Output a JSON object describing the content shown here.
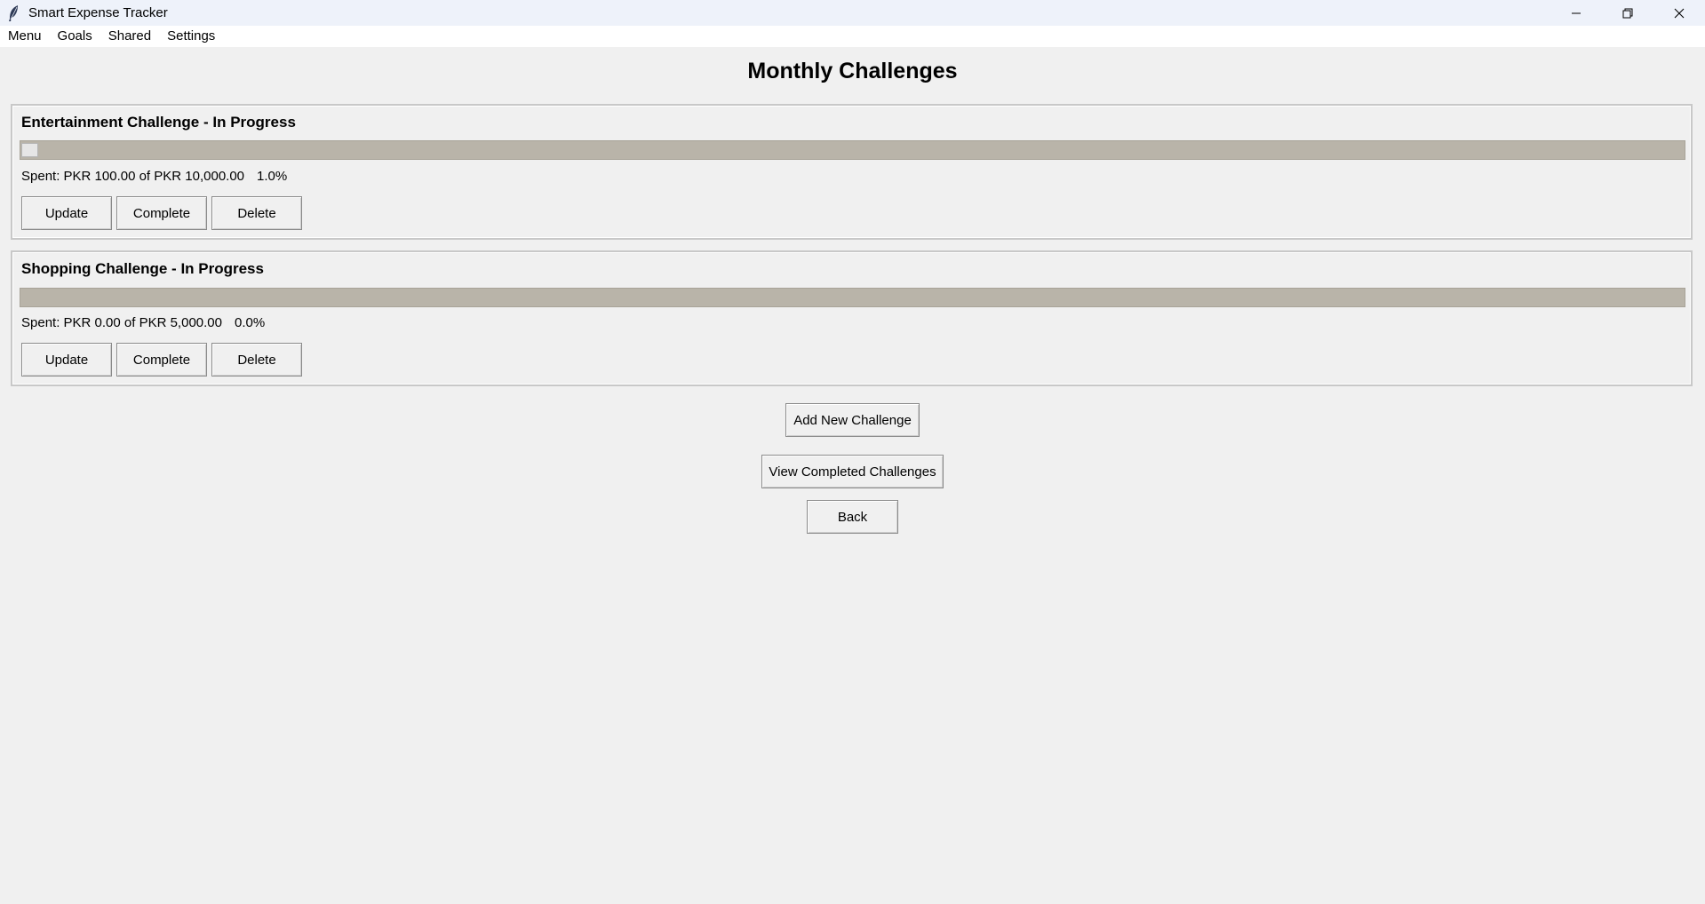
{
  "window": {
    "title": "Smart Expense Tracker",
    "icon": "feather-icon",
    "controls": [
      "minimize-icon",
      "restore-icon",
      "close-icon"
    ]
  },
  "menubar": {
    "items": [
      "Menu",
      "Goals",
      "Shared",
      "Settings"
    ]
  },
  "page": {
    "title": "Monthly Challenges"
  },
  "challenges": [
    {
      "title": "Entertainment Challenge - In Progress",
      "spent_text": "Spent: PKR 100.00 of PKR 10,000.00",
      "percent_text": "1.0%",
      "progress": 0.01,
      "buttons": {
        "update": "Update",
        "complete": "Complete",
        "delete": "Delete"
      }
    },
    {
      "title": "Shopping Challenge - In Progress",
      "spent_text": "Spent: PKR 0.00 of PKR 5,000.00",
      "percent_text": "0.0%",
      "progress": 0.0,
      "buttons": {
        "update": "Update",
        "complete": "Complete",
        "delete": "Delete"
      }
    }
  ],
  "actions": {
    "add_new": "Add New Challenge",
    "view_completed": "View Completed Challenges",
    "back": "Back"
  },
  "colors": {
    "window_bg": "#f0f0f0",
    "titlebar_bg": "#eef2fa",
    "progress_trough": "#b9b4a9"
  }
}
